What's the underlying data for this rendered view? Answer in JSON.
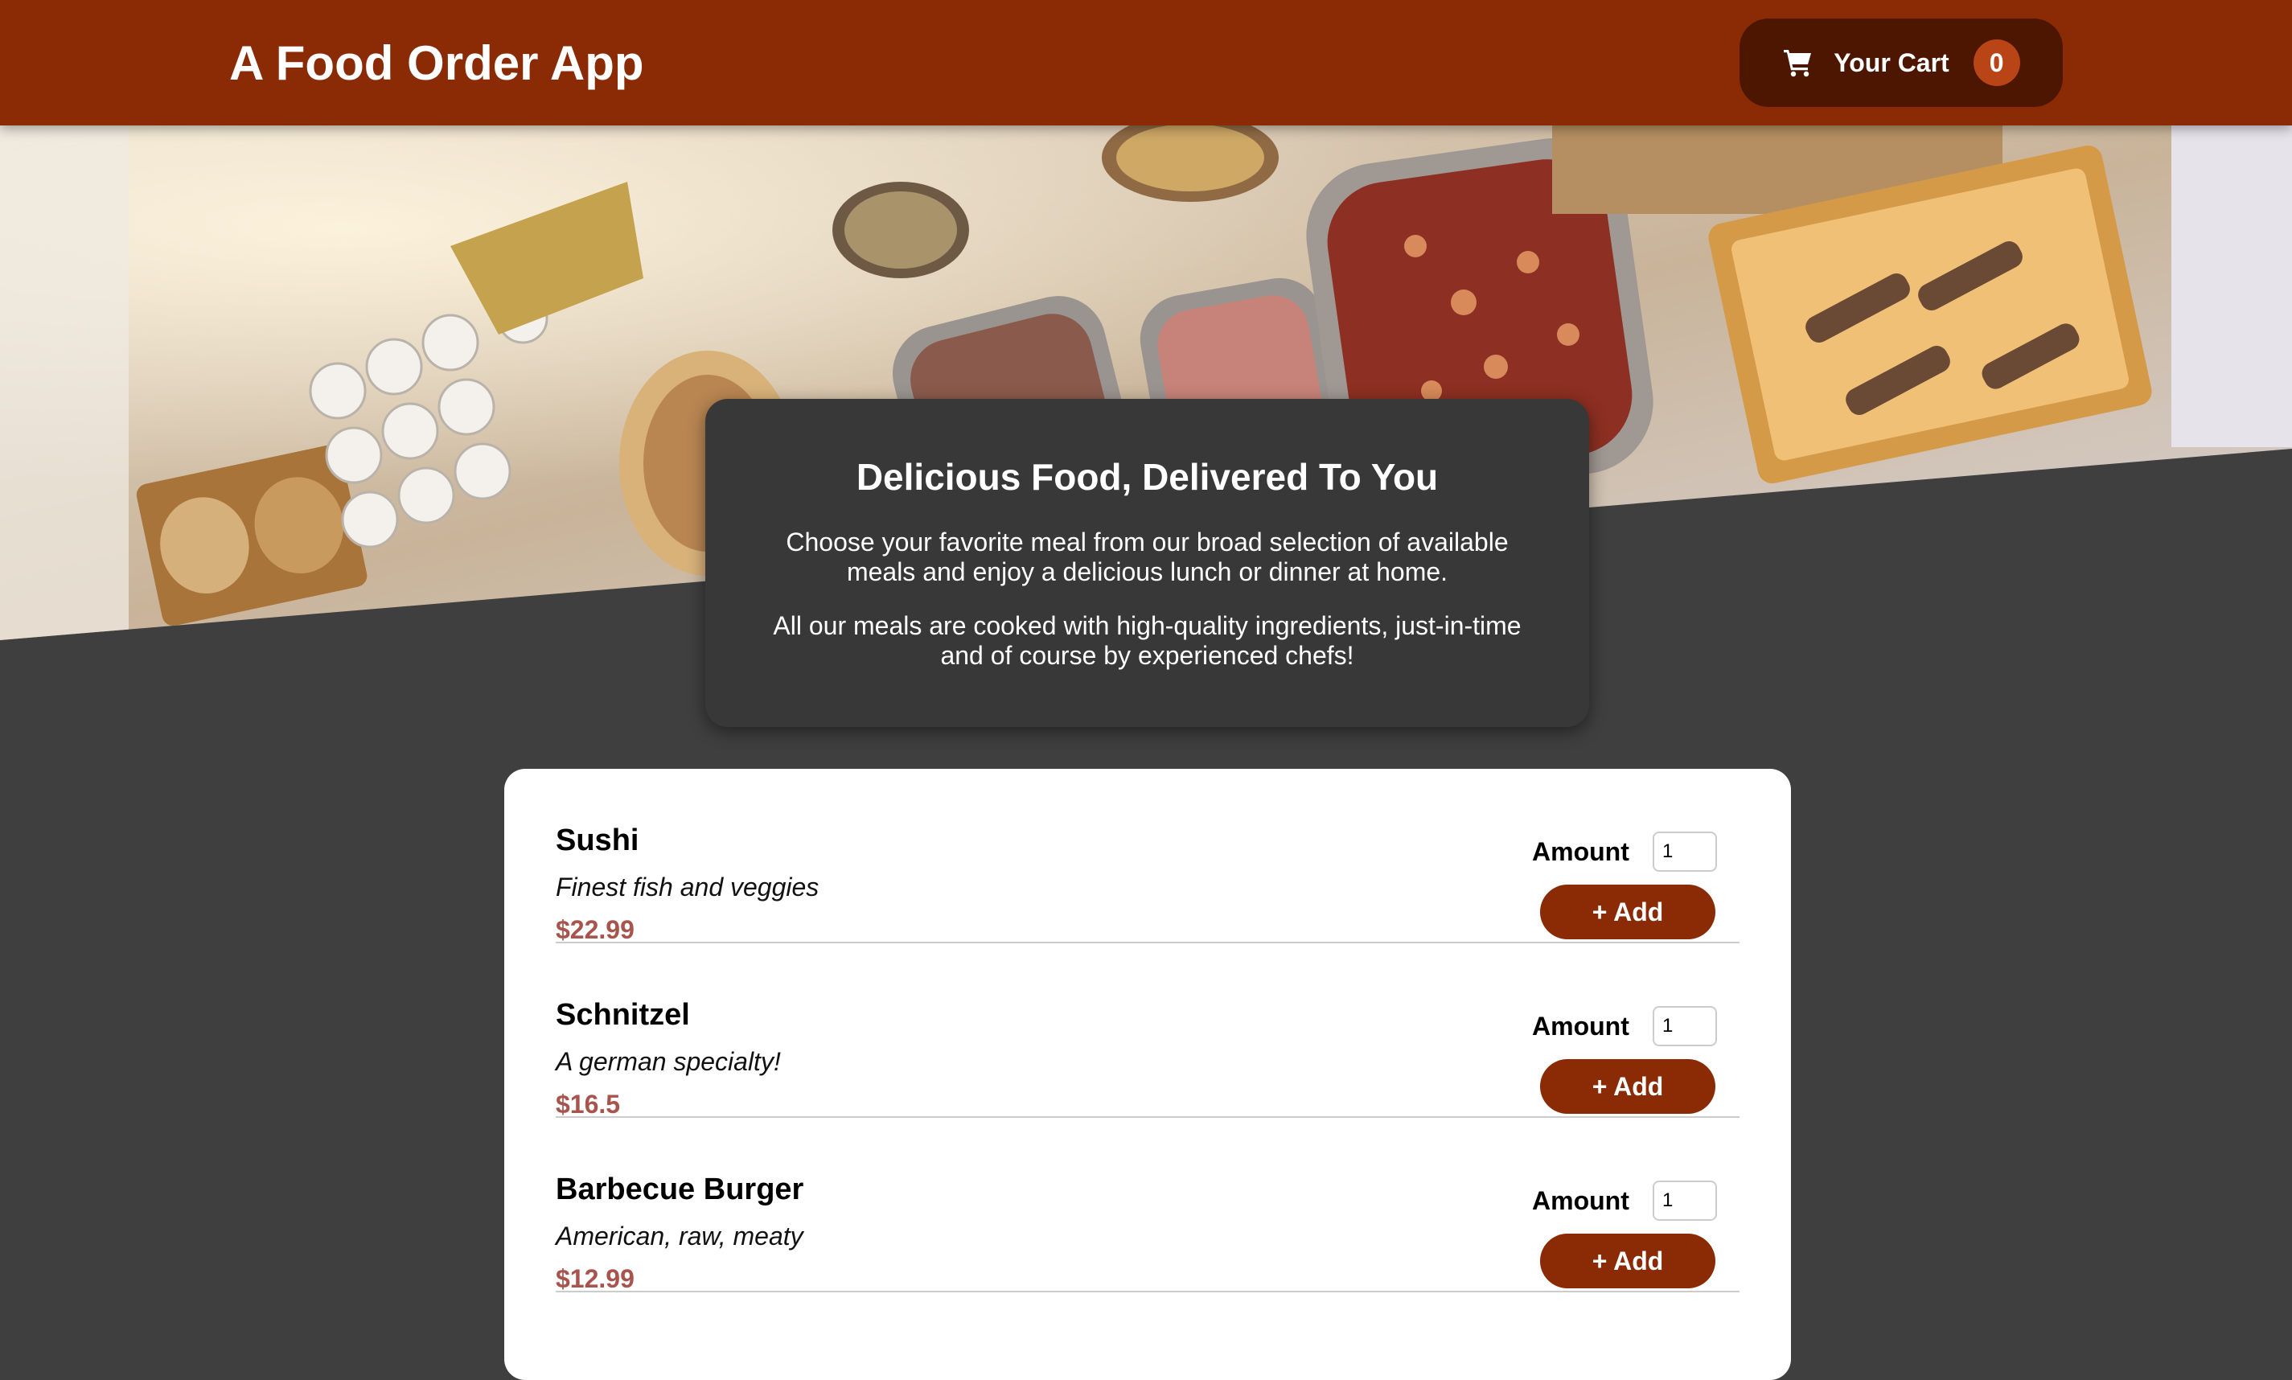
{
  "header": {
    "title": "A Food Order App",
    "cart": {
      "icon": "cart-icon",
      "label": "Your Cart",
      "count": "0"
    }
  },
  "summary": {
    "heading": "Delicious Food, Delivered To You",
    "paragraphs": [
      "Choose your favorite meal from our broad selection of available meals and enjoy a delicious lunch or dinner at home.",
      "All our meals are cooked with high-quality ingredients, just-in-time and of course by experienced chefs!"
    ]
  },
  "meals": [
    {
      "name": "Sushi",
      "description": "Finest fish and veggies",
      "price": "$22.99",
      "amount_label": "Amount",
      "amount_value": "1",
      "add_label": "+ Add"
    },
    {
      "name": "Schnitzel",
      "description": "A german specialty!",
      "price": "$16.5",
      "amount_label": "Amount",
      "amount_value": "1",
      "add_label": "+ Add"
    },
    {
      "name": "Barbecue Burger",
      "description": "American, raw, meaty",
      "price": "$12.99",
      "amount_label": "Amount",
      "amount_value": "1",
      "add_label": "+ Add"
    }
  ],
  "colors": {
    "header": "#8a2b06",
    "cart_button": "#4d1601",
    "badge": "#b94517",
    "background": "#3f3f3f",
    "summary_card": "#383838",
    "price": "#a8534c"
  }
}
